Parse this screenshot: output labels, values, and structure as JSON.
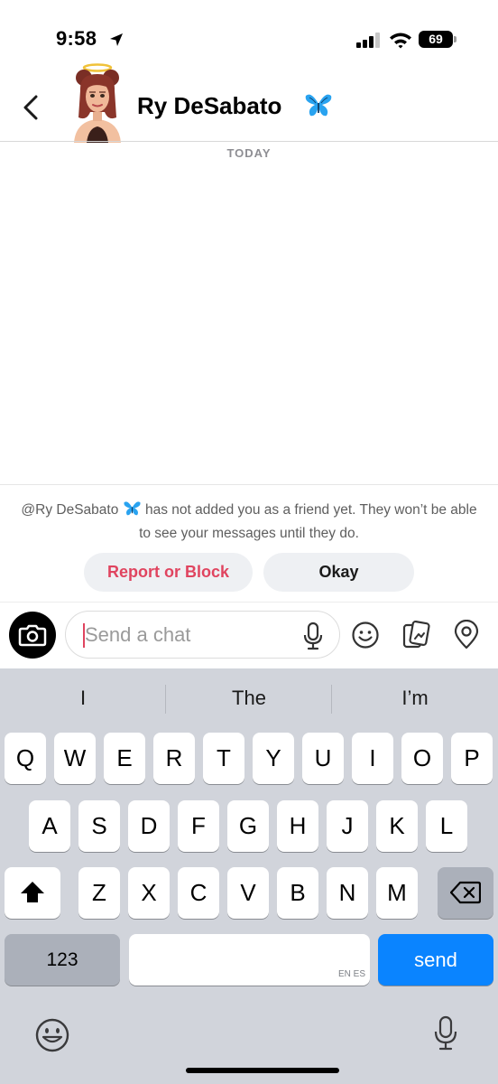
{
  "status_bar": {
    "time": "9:58",
    "battery": "69"
  },
  "header": {
    "contact_name": "Ry DeSabato",
    "name_emoji": "🦋"
  },
  "chat": {
    "date_label": "TODAY"
  },
  "notice": {
    "before": "@Ry DeSabato",
    "after": " has not added you as a friend yet. They won’t be able to see your messages until they do.",
    "report_label": "Report or Block",
    "okay_label": "Okay"
  },
  "input": {
    "placeholder": "Send a chat"
  },
  "keyboard": {
    "suggestions": [
      "I",
      "The",
      "I’m"
    ],
    "row1": [
      "Q",
      "W",
      "E",
      "R",
      "T",
      "Y",
      "U",
      "I",
      "O",
      "P"
    ],
    "row2": [
      "A",
      "S",
      "D",
      "F",
      "G",
      "H",
      "J",
      "K",
      "L"
    ],
    "row3": [
      "Z",
      "X",
      "C",
      "V",
      "B",
      "N",
      "M"
    ],
    "numbers_label": "123",
    "send_label": "send",
    "space_languages": "EN ES"
  },
  "colors": {
    "accent_red": "#e0445f",
    "send_blue": "#0a84ff",
    "keyboard_bg": "#d1d4db"
  }
}
